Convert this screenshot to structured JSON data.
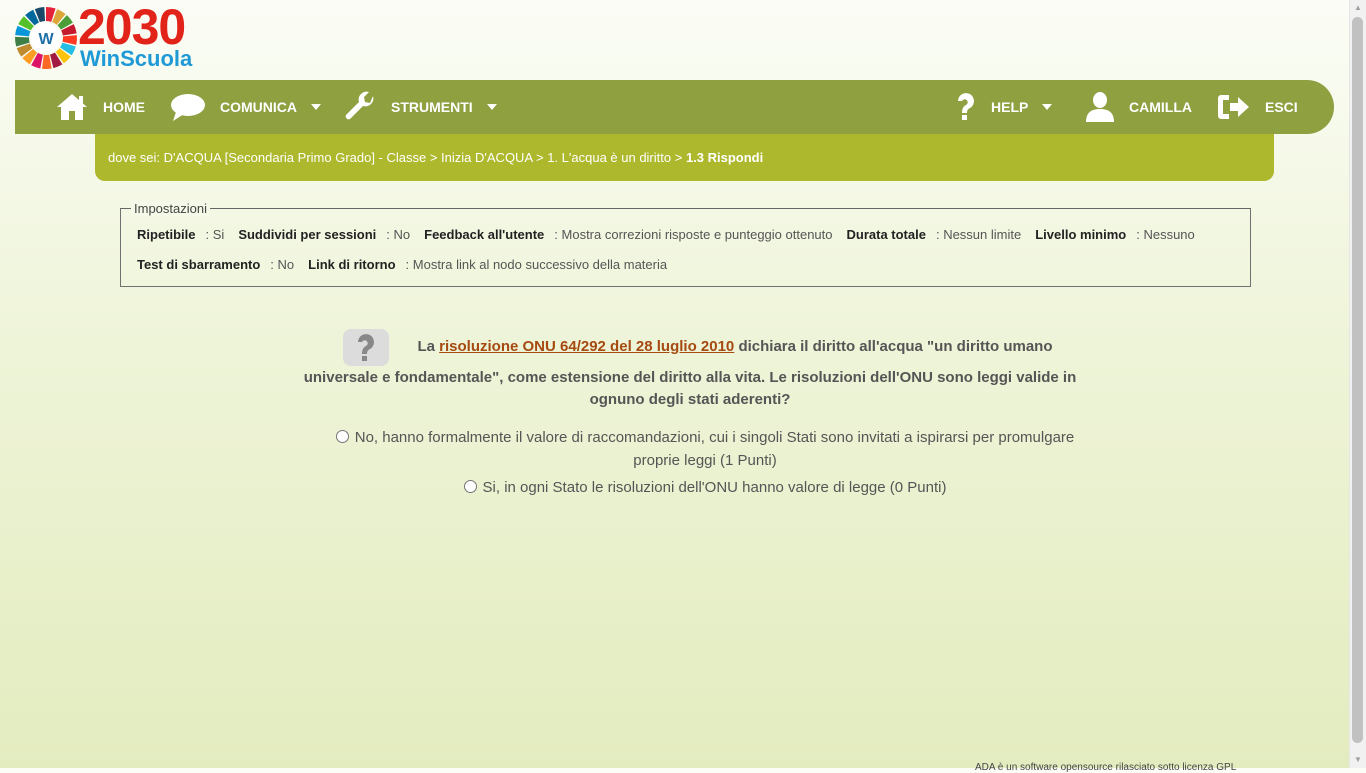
{
  "logo": {
    "year": "2030",
    "brand": "WinScuola",
    "wheel_letter": "W"
  },
  "navbar": {
    "home": "HOME",
    "comunica": "COMUNICA",
    "strumenti": "STRUMENTI",
    "help": "HELP",
    "user": "CAMILLA",
    "esci": "ESCI"
  },
  "breadcrumb": {
    "prefix": "dove sei: ",
    "path": "D'ACQUA [Secondaria Primo Grado] - Classe > Inizia D'ACQUA > 1. L'acqua è un diritto > ",
    "current": "1.3 Rispondi"
  },
  "settings": {
    "legend": "Impostazioni",
    "ripetibile_label": "Ripetibile",
    "ripetibile_value": ": Si",
    "sessioni_label": "Suddividi per sessioni",
    "sessioni_value": ": No",
    "feedback_label": "Feedback all'utente",
    "feedback_value": ": Mostra correzioni risposte e punteggio ottenuto",
    "durata_label": "Durata totale",
    "durata_value": ": Nessun limite",
    "livello_label": "Livello minimo",
    "livello_value": ": Nessuno",
    "sbarramento_label": "Test di sbarramento",
    "sbarramento_value": ": No",
    "ritorno_label": "Link di ritorno",
    "ritorno_value": ": Mostra link al nodo successivo della materia"
  },
  "question": {
    "before": "La ",
    "link": "risoluzione ONU 64/292 del 28 luglio 2010",
    "after1": " dichiara il diritto all'acqua \"un diritto umano",
    "rest": "universale e fondamentale\", come estensione del diritto alla vita. Le risoluzioni dell'ONU sono leggi valide in ognuno degli stati aderenti?"
  },
  "answers": [
    "No, hanno formalmente il valore di raccomandazioni, cui i singoli Stati sono invitati a ispirarsi per promulgare proprie leggi (1 Punti)",
    "Si, in ogni Stato le risoluzioni dell'ONU hanno valore di legge (0 Punti)"
  ],
  "footer": {
    "text": "ADA è un software opensource rilasciato sotto licenza GPL"
  },
  "colors": {
    "navbar": "#8ea040",
    "breadcrumb": "#adb82c",
    "link": "#a54a10",
    "logo_red": "#e2231a",
    "logo_blue": "#1f9ad6"
  }
}
